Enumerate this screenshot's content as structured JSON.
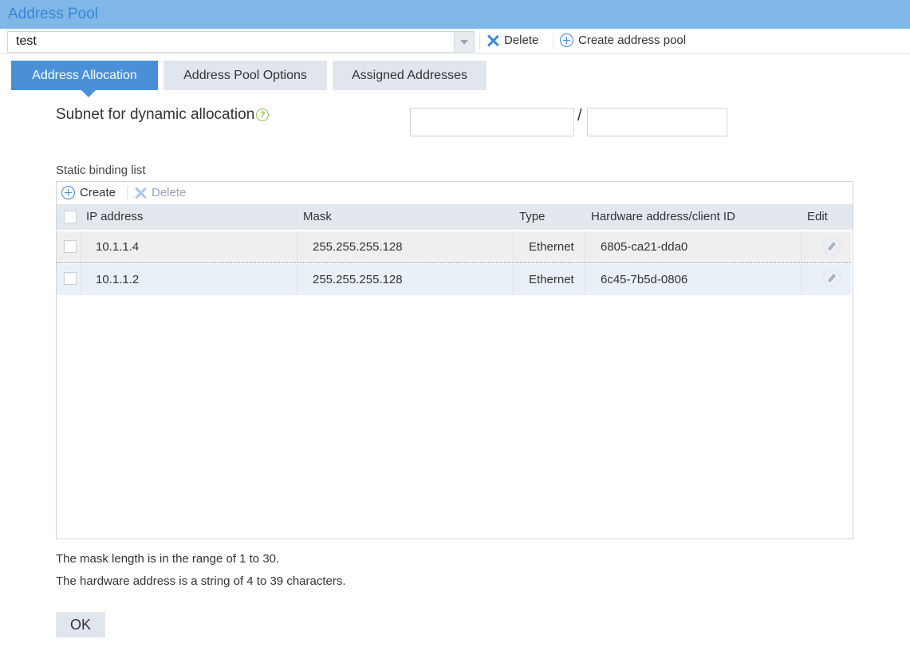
{
  "window": {
    "title": "Address Pool"
  },
  "pool": {
    "selected": "test"
  },
  "toolbar": {
    "delete_label": "Delete",
    "create_label": "Create address pool"
  },
  "tabs": [
    {
      "label": "Address Allocation",
      "active": true
    },
    {
      "label": "Address Pool Options",
      "active": false
    },
    {
      "label": "Assigned Addresses",
      "active": false
    }
  ],
  "subnet": {
    "label": "Subnet for dynamic allocation",
    "separator": "/",
    "address_value": "",
    "mask_value": ""
  },
  "static_list": {
    "label": "Static binding list",
    "create_label": "Create",
    "delete_label": "Delete",
    "columns": [
      "IP address",
      "Mask",
      "Type",
      "Hardware address/client ID",
      "Edit"
    ],
    "rows": [
      {
        "ip": "10.1.1.4",
        "mask": "255.255.255.128",
        "type": "Ethernet",
        "hw": "6805-ca21-dda0"
      },
      {
        "ip": "10.1.1.2",
        "mask": "255.255.255.128",
        "type": "Ethernet",
        "hw": "6c45-7b5d-0806"
      }
    ]
  },
  "notes": [
    "The mask length is in the range of 1 to 30.",
    "The hardware address is a string of 4 to 39 characters."
  ],
  "ok_label": "OK",
  "colors": {
    "title_bar": "#7fb7e9",
    "title_text": "#3a86d4",
    "accent": "#4a90d9",
    "tab_inactive": "#e1e6ee",
    "help": "#8bc34a"
  }
}
